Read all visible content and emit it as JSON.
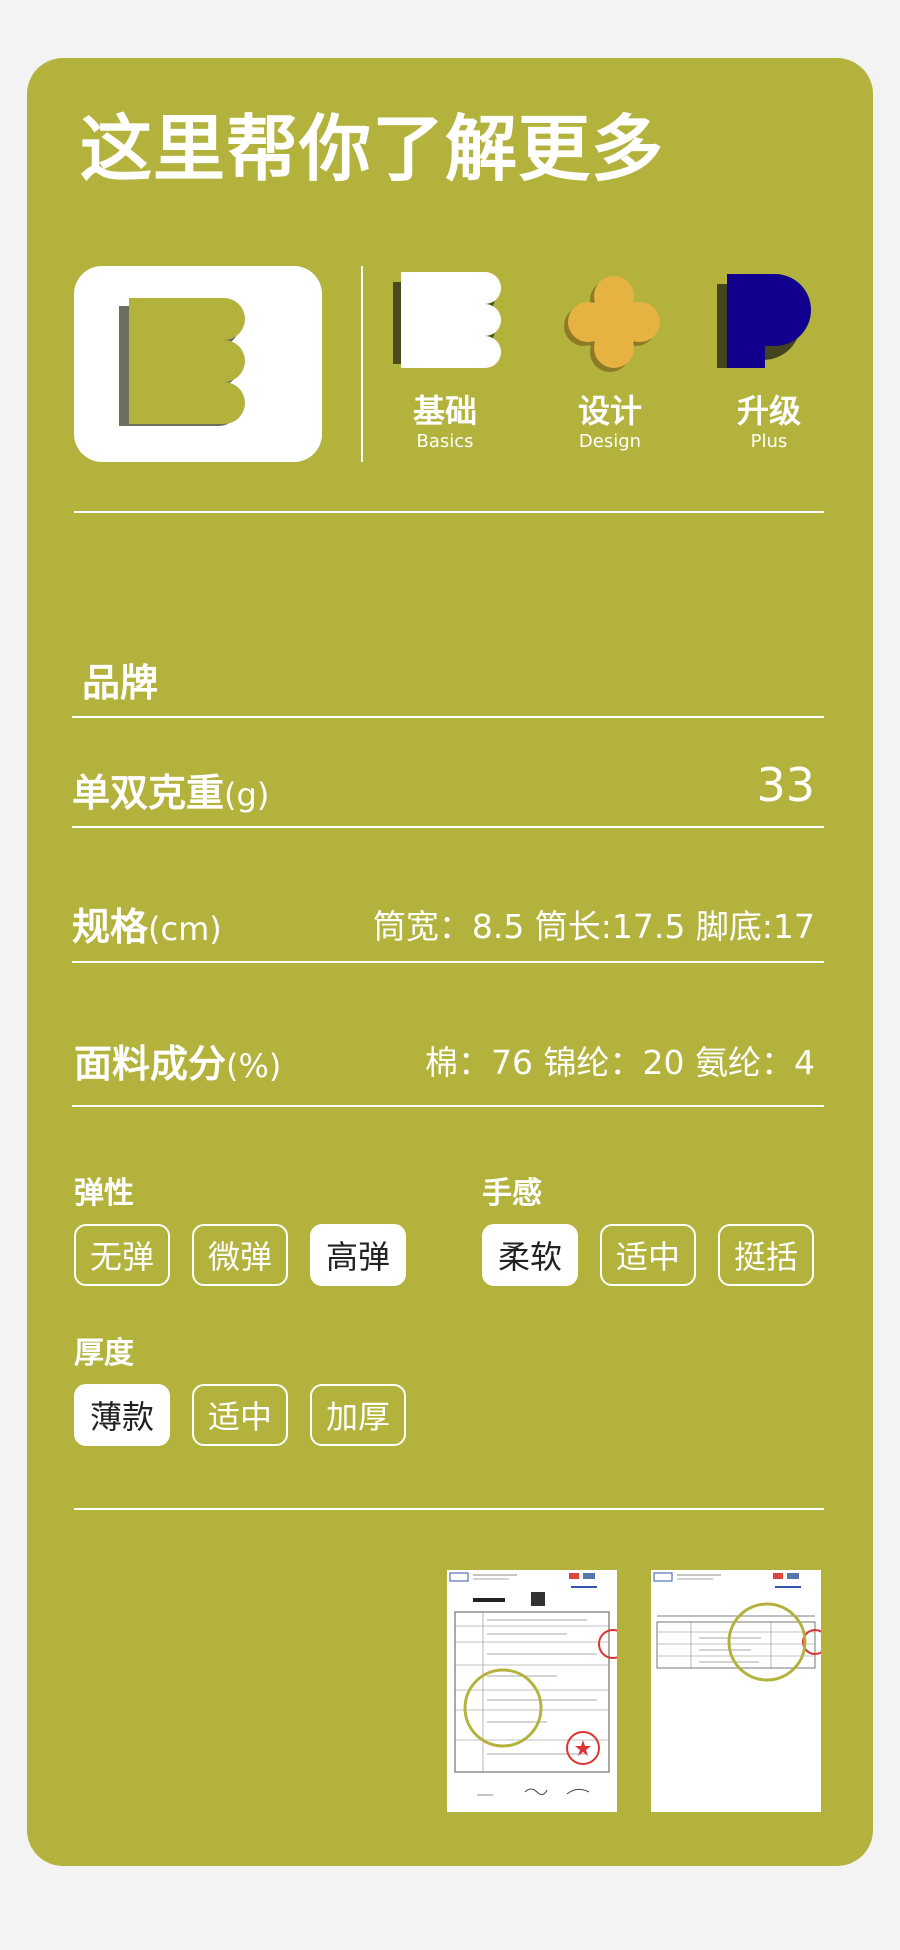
{
  "title": "这里帮你了解更多",
  "levels": [
    {
      "zh": "基础",
      "en": "Basics"
    },
    {
      "zh": "设计",
      "en": "Design"
    },
    {
      "zh": "升级",
      "en": "Plus"
    }
  ],
  "brand": {
    "label": "品牌"
  },
  "weight": {
    "label": "单双克重",
    "unit": "(g)",
    "value": "33"
  },
  "spec": {
    "label": "规格",
    "unit": "(cm)",
    "value": "筒宽：8.5 筒长:17.5  脚底:17"
  },
  "fabric": {
    "label": "面料成分",
    "unit": "(%)",
    "value": "棉：76  锦纶：20  氨纶：4"
  },
  "elasticity": {
    "label": "弹性",
    "options": [
      "无弹",
      "微弹",
      "高弹"
    ],
    "selected": "高弹"
  },
  "feel": {
    "label": "手感",
    "options": [
      "柔软",
      "适中",
      "挺括"
    ],
    "selected": "柔软"
  },
  "thickness": {
    "label": "厚度",
    "options": [
      "薄款",
      "适中",
      "加厚"
    ],
    "selected": "薄款"
  },
  "colors": {
    "background": "#b3b23d",
    "dark_shadow": "#5b5a1d",
    "design_accent": "#e6b342",
    "plus_accent": "#11008e",
    "page": "#f3f3f3"
  },
  "icons": [
    "basics-logo-icon",
    "basics-icon",
    "design-icon",
    "plus-icon",
    "magnifier-icon",
    "stamp-icon"
  ]
}
